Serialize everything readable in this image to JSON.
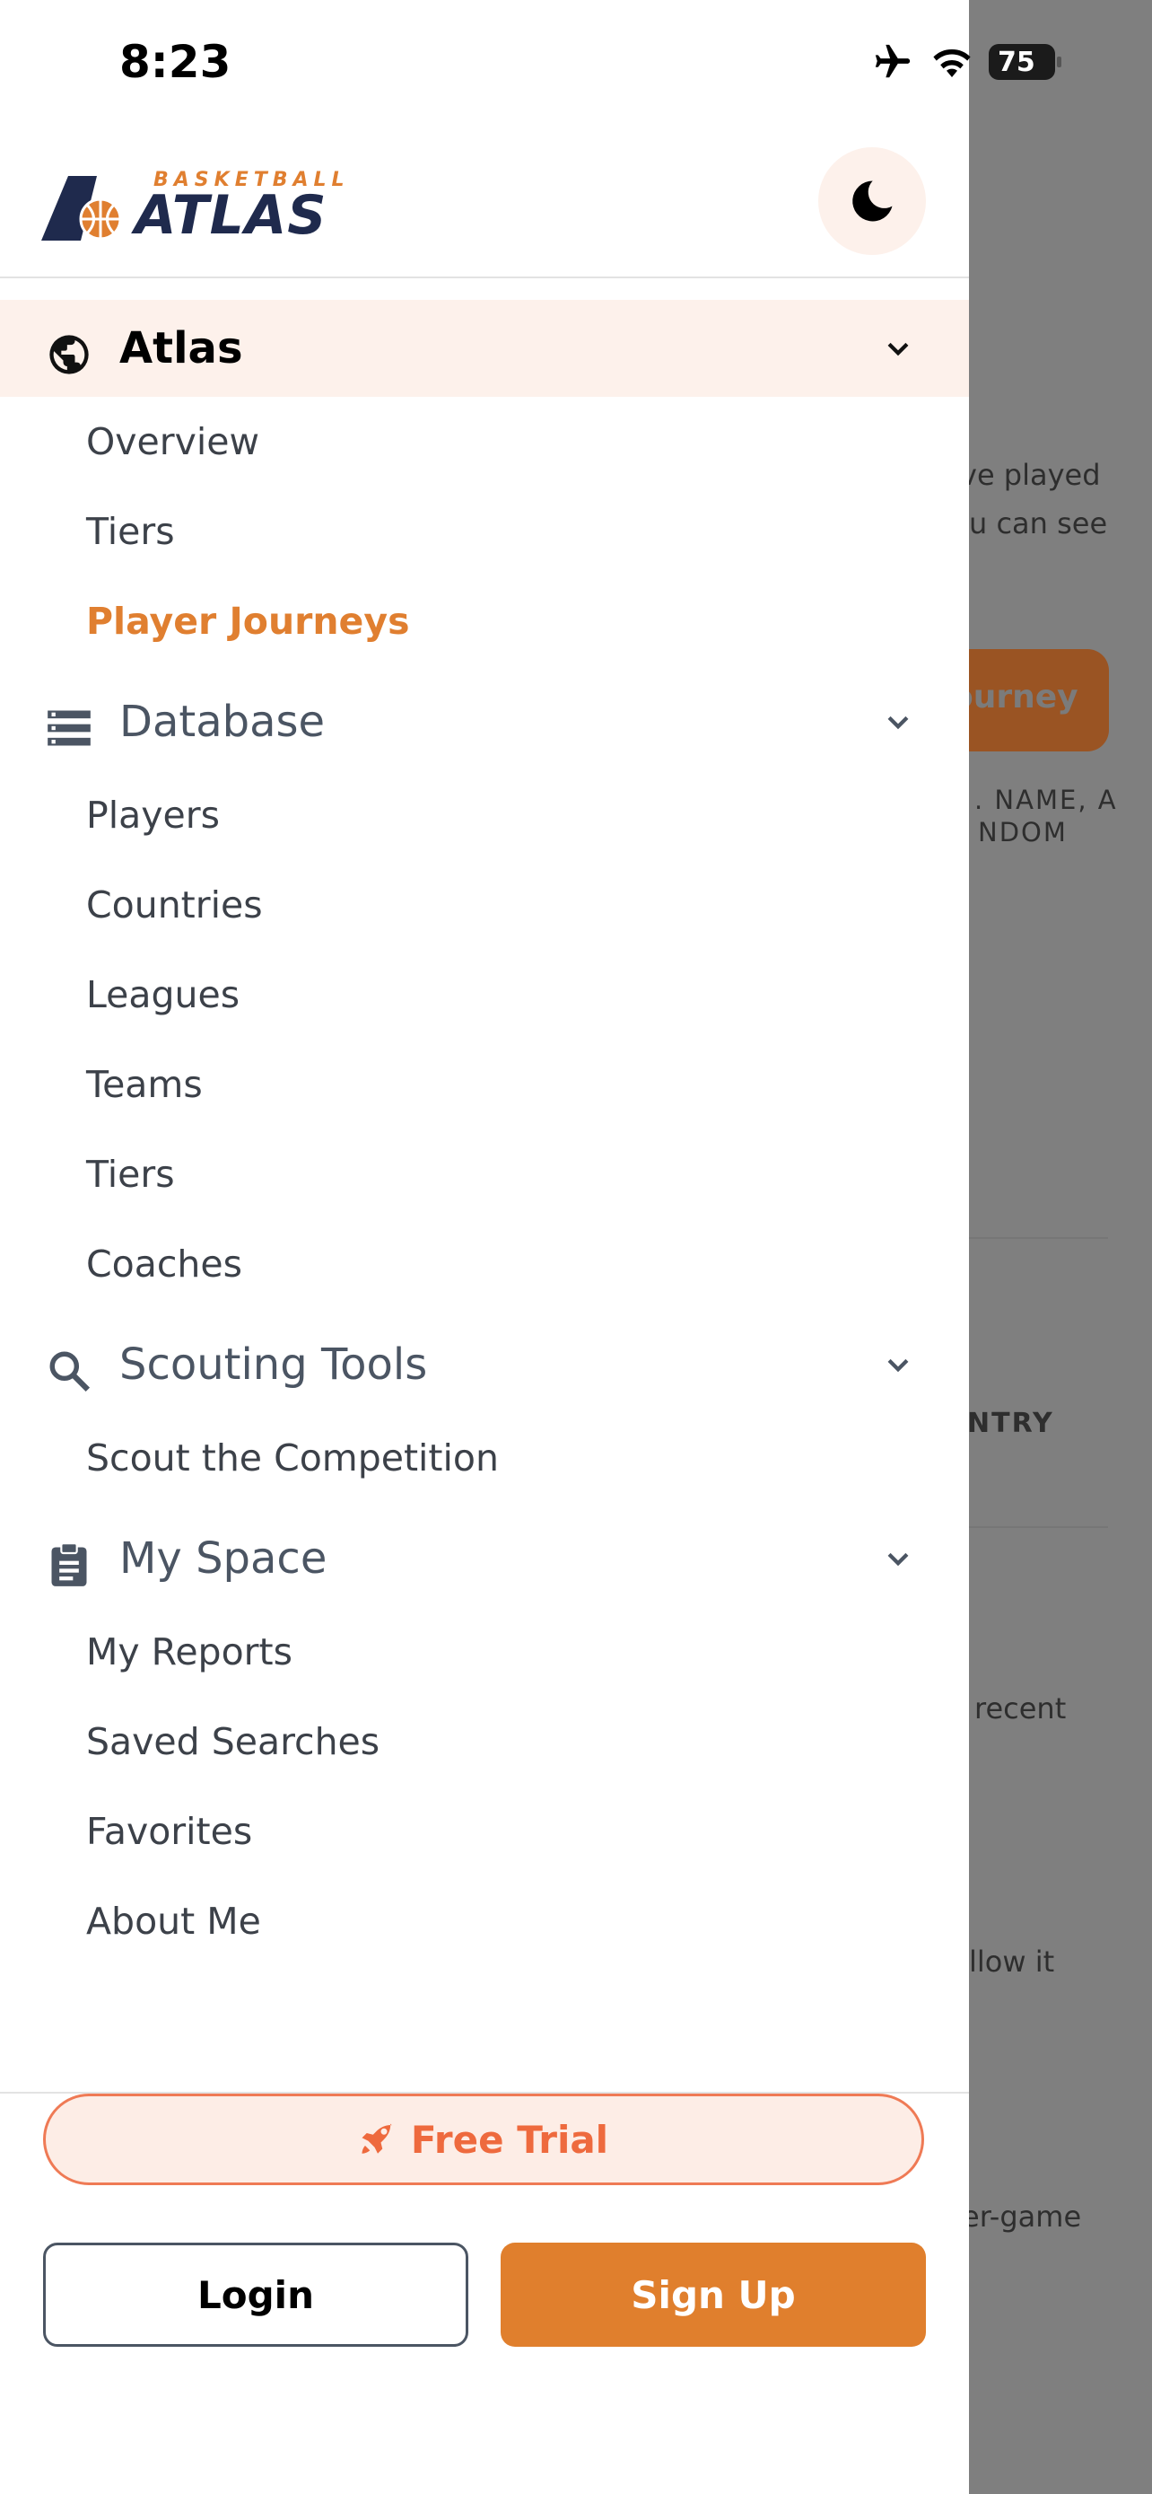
{
  "status_bar": {
    "time": "8:23",
    "battery": "75"
  },
  "brand": {
    "top": "BASKETBALL",
    "main": "ATLAS"
  },
  "nav": {
    "sections": [
      {
        "label": "Atlas",
        "icon": "globe-icon",
        "active": true,
        "items": [
          {
            "label": "Overview"
          },
          {
            "label": "Tiers"
          },
          {
            "label": "Player Journeys",
            "current": true
          }
        ]
      },
      {
        "label": "Database",
        "icon": "database-icon",
        "items": [
          {
            "label": "Players"
          },
          {
            "label": "Countries"
          },
          {
            "label": "Leagues"
          },
          {
            "label": "Teams"
          },
          {
            "label": "Tiers"
          },
          {
            "label": "Coaches"
          }
        ]
      },
      {
        "label": "Scouting Tools",
        "icon": "search-icon",
        "items": [
          {
            "label": "Scout the Competition"
          }
        ]
      },
      {
        "label": "My Space",
        "icon": "clipboard-icon",
        "items": [
          {
            "label": "My Reports"
          },
          {
            "label": "Saved Searches"
          },
          {
            "label": "Favorites"
          },
          {
            "label": "About Me"
          }
        ]
      }
    ]
  },
  "actions": {
    "free_trial": "Free Trial",
    "login": "Login",
    "signup": "Sign Up"
  },
  "background": {
    "fragments": [
      "ve played",
      "u can see",
      ". NAME, A",
      "NDOM",
      "NTRY",
      "recent",
      "llow it",
      "er-game"
    ],
    "button_fragment": "ourney"
  },
  "colors": {
    "accent": "#e07f30",
    "accent_soft": "#fdf1eb",
    "navy": "#1f2a4d",
    "text": "#4b5563"
  }
}
